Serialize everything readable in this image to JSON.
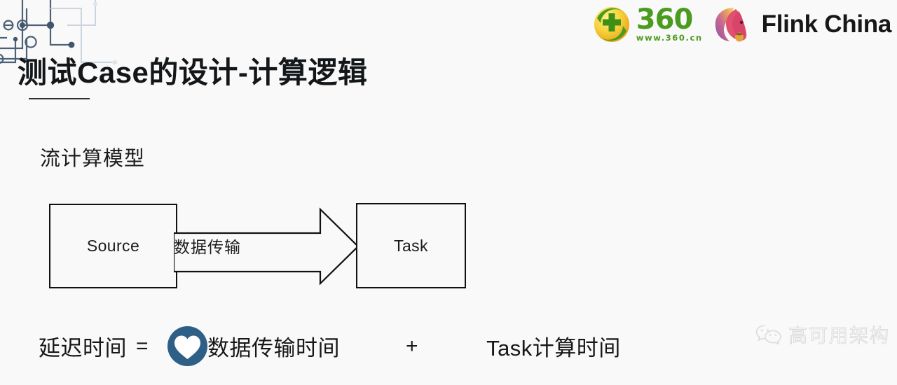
{
  "slide": {
    "title": "测试Case的设计-计算逻辑",
    "section_label": "流计算模型",
    "background_color": "#f9f9f9"
  },
  "branding": {
    "logo_360": {
      "wordmark": "360",
      "url": "www.360.cn",
      "color": "#4b9b1f",
      "mark_icon": "360-shield-plus-icon"
    },
    "flink": {
      "label": "Flink China",
      "mark_icon": "flink-squirrel-icon",
      "color": "#171717"
    }
  },
  "diagram": {
    "source_box": "Source",
    "task_box": "Task",
    "arrow_label": "数据传输",
    "arrow_icon": "block-arrow-right-icon",
    "stroke_color": "#111111"
  },
  "formula": {
    "latency": "延迟时间",
    "equals": "=",
    "heart_icon": "heart-in-circle-icon",
    "heart_circle_color": "#2e5f87",
    "transfer_time": "数据传输时间",
    "plus": "+",
    "task_time": "Task计算时间"
  },
  "watermark": {
    "icon": "wechat-icon",
    "text": "高可用架构",
    "color": "#c9c9c9"
  },
  "decoration": {
    "circuit_icon": "circuit-lines-decoration",
    "line_color": "#4d6176",
    "faint_line_color": "#ccd5de"
  }
}
